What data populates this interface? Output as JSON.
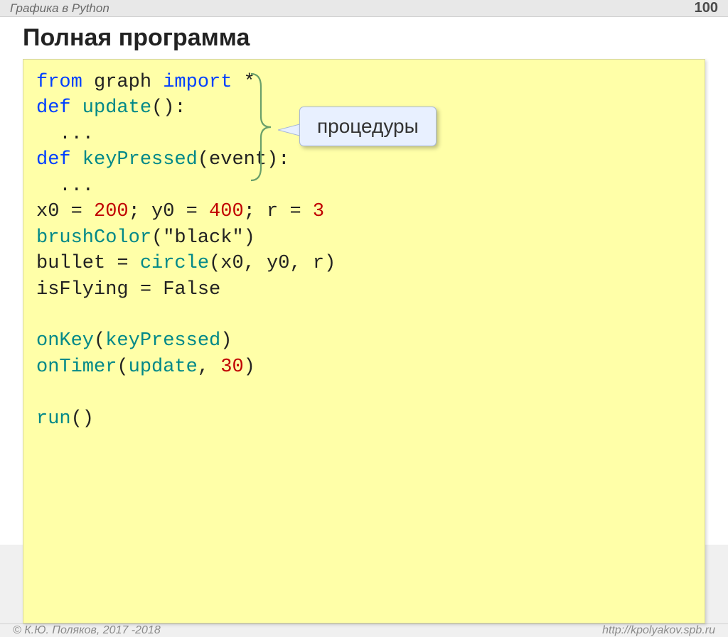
{
  "header": {
    "title": "Графика в Python",
    "page": "100"
  },
  "heading": "Полная программа",
  "callout": "процедуры",
  "code": {
    "l1_from": "from",
    "l1_graph": " graph ",
    "l1_import": "import",
    "l1_star": " *",
    "l2_def": "def",
    "l2_update": " update",
    "l2_paren": "():",
    "l3_dots": "  ...",
    "l4_def": "def",
    "l4_key": " keyPressed",
    "l4_args": "(event):",
    "l5_dots": "  ...",
    "l6_a": "x0 = ",
    "l6_v1": "200",
    "l6_b": "; y0 = ",
    "l6_v2": "400",
    "l6_c": "; r = ",
    "l6_v3": "3",
    "l7_fn": "brushColor",
    "l7_arg": "(\"black\")",
    "l8_a": "bullet = ",
    "l8_fn": "circle",
    "l8_b": "(x0, y0, r)",
    "l9": "isFlying = False",
    "l10_fn": "onKey",
    "l10_a": "(",
    "l10_arg": "keyPressed",
    "l10_b": ")",
    "l11_fn": "onTimer",
    "l11_a": "(",
    "l11_arg": "update",
    "l11_b": ", ",
    "l11_num": "30",
    "l11_c": ")",
    "l12_fn": "run",
    "l12_a": "()"
  },
  "footer": {
    "left": "© К.Ю. Поляков, 2017 -2018",
    "right": "http://kpolyakov.spb.ru"
  }
}
